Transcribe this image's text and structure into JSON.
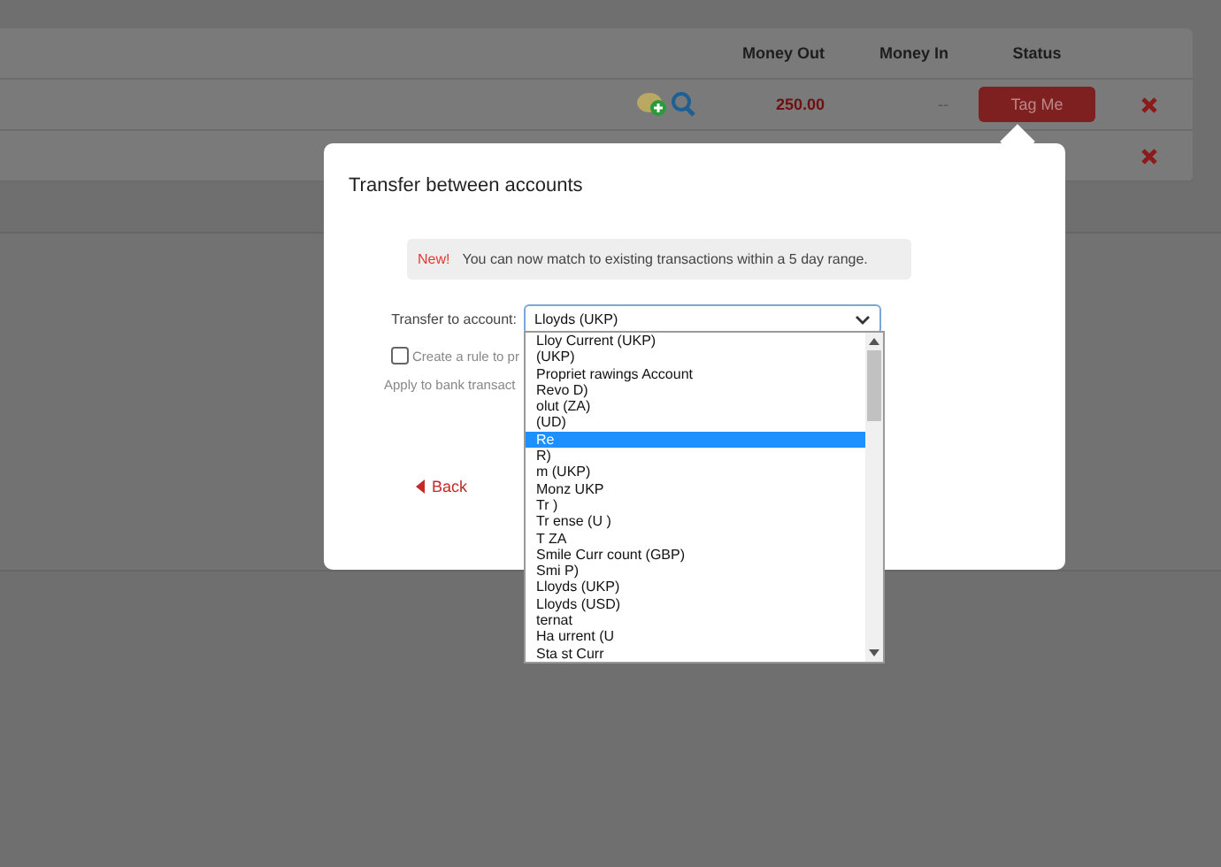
{
  "page": {
    "columns": [
      "Money Out",
      "Money In",
      "Status"
    ],
    "rows": [
      {
        "money_out": "250.00",
        "money_in": "--",
        "status": "Tag Me"
      },
      {
        "money_out": "",
        "money_in": "",
        "status": ""
      }
    ]
  },
  "dialog": {
    "title": "Transfer between accounts",
    "notice": {
      "badge": "New!",
      "text": "You can now match to existing transactions within a 5 day range."
    },
    "field_label": "Transfer to account:",
    "field_value": "Lloyds (UKP)",
    "rule_checkbox": {
      "label": "Create a rule to pr",
      "checked": false
    },
    "apply_text": "Apply to bank transact",
    "back": "Back",
    "options": [
      {
        "label": "Lloy Current (UKP)",
        "selected": false
      },
      {
        "label": "(UKP)",
        "selected": false
      },
      {
        "label": "Propriet rawings Account",
        "selected": false
      },
      {
        "label": "Revo D)",
        "selected": false
      },
      {
        "label": "olut (ZA)",
        "selected": false
      },
      {
        "label": "(UD)",
        "selected": false
      },
      {
        "label": "Re",
        "selected": true
      },
      {
        "label": "R)",
        "selected": false
      },
      {
        "label": "m (UKP)",
        "selected": false
      },
      {
        "label": "Monz UKP",
        "selected": false
      },
      {
        "label": "Tr )",
        "selected": false
      },
      {
        "label": "Tr ense (U )",
        "selected": false
      },
      {
        "label": "T ZA",
        "selected": false
      },
      {
        "label": "Smile Curr count (GBP)",
        "selected": false
      },
      {
        "label": "Smi P)",
        "selected": false
      },
      {
        "label": "Lloyds (UKP)",
        "selected": false
      },
      {
        "label": "Lloyds (USD)",
        "selected": false
      },
      {
        "label": "ternat",
        "selected": false
      },
      {
        "label": "Ha urrent (U",
        "selected": false
      },
      {
        "label": "Sta st Curr",
        "selected": false
      }
    ]
  }
}
